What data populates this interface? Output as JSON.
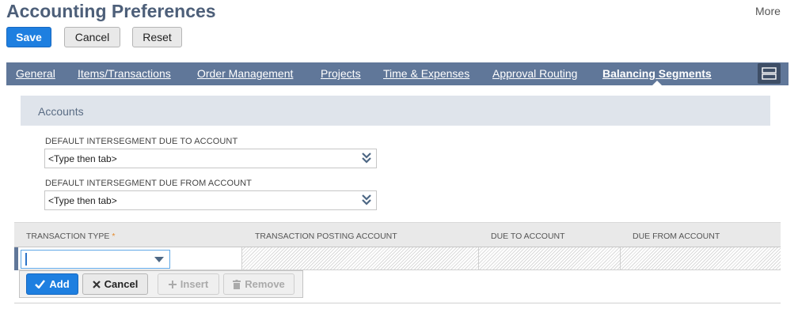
{
  "page": {
    "title": "Accounting Preferences",
    "more_label": "More"
  },
  "toolbar": {
    "save_label": "Save",
    "cancel_label": "Cancel",
    "reset_label": "Reset"
  },
  "tabs": [
    {
      "label": "General",
      "active": false
    },
    {
      "label": "Items/Transactions",
      "active": false
    },
    {
      "label": "Order Management",
      "active": false
    },
    {
      "label": "Projects",
      "active": false
    },
    {
      "label": "Time & Expenses",
      "active": false
    },
    {
      "label": "Approval Routing",
      "active": false
    },
    {
      "label": "Balancing Segments",
      "active": true
    }
  ],
  "section": {
    "title": "Accounts"
  },
  "fields": {
    "due_to": {
      "label": "DEFAULT INTERSEGMENT DUE TO ACCOUNT",
      "value": "<Type then tab>"
    },
    "due_from": {
      "label": "DEFAULT INTERSEGMENT DUE FROM ACCOUNT",
      "value": "<Type then tab>"
    }
  },
  "grid": {
    "columns": [
      "TRANSACTION TYPE",
      "TRANSACTION POSTING ACCOUNT",
      "DUE TO ACCOUNT",
      "DUE FROM ACCOUNT"
    ],
    "required_marker": "*"
  },
  "actions": {
    "add_label": "Add",
    "cancel_label": "Cancel",
    "insert_label": "Insert",
    "remove_label": "Remove"
  },
  "icons": {
    "select_dropdown": "double-chevron-down-icon",
    "layout": "layout-toggle-icon"
  },
  "colors": {
    "accent_blue": "#1e7fe0",
    "tab_bar": "#607799",
    "title": "#4d5f79",
    "required": "#e58a2b"
  }
}
